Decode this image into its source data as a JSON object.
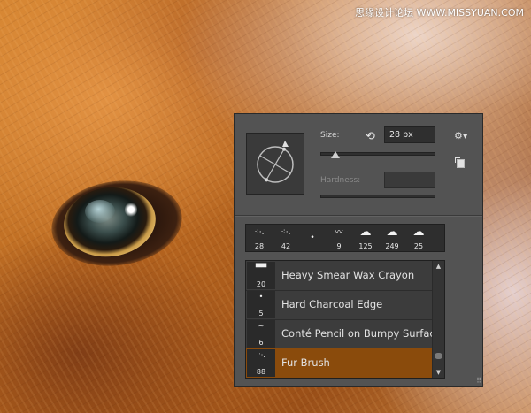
{
  "watermark": "思缘设计论坛 WWW.MISSYUAN.COM",
  "panel": {
    "size_label": "Size:",
    "size_value": "28 px",
    "size_level": 0.13,
    "hardness_label": "Hardness:",
    "hardness_value": "",
    "reset_icon": "reset-arrow-icon",
    "gear_icon": "gear-icon",
    "new_preset_icon": "new-preset-icon"
  },
  "thumbnails": [
    {
      "num": "28"
    },
    {
      "num": "42"
    },
    {
      "num": ""
    },
    {
      "num": "9"
    },
    {
      "num": "125"
    },
    {
      "num": "249"
    },
    {
      "num": "25"
    }
  ],
  "presets": [
    {
      "num": "20",
      "name": "Heavy Smear Wax Crayon",
      "selected": false
    },
    {
      "num": "5",
      "name": "Hard Charcoal Edge",
      "selected": false
    },
    {
      "num": "6",
      "name": "Conté Pencil on Bumpy Surfac",
      "selected": false
    },
    {
      "num": "88",
      "name": "Fur Brush",
      "selected": true
    }
  ],
  "colors": {
    "panel_bg": "#535353",
    "selection": "#8a4b0c"
  }
}
